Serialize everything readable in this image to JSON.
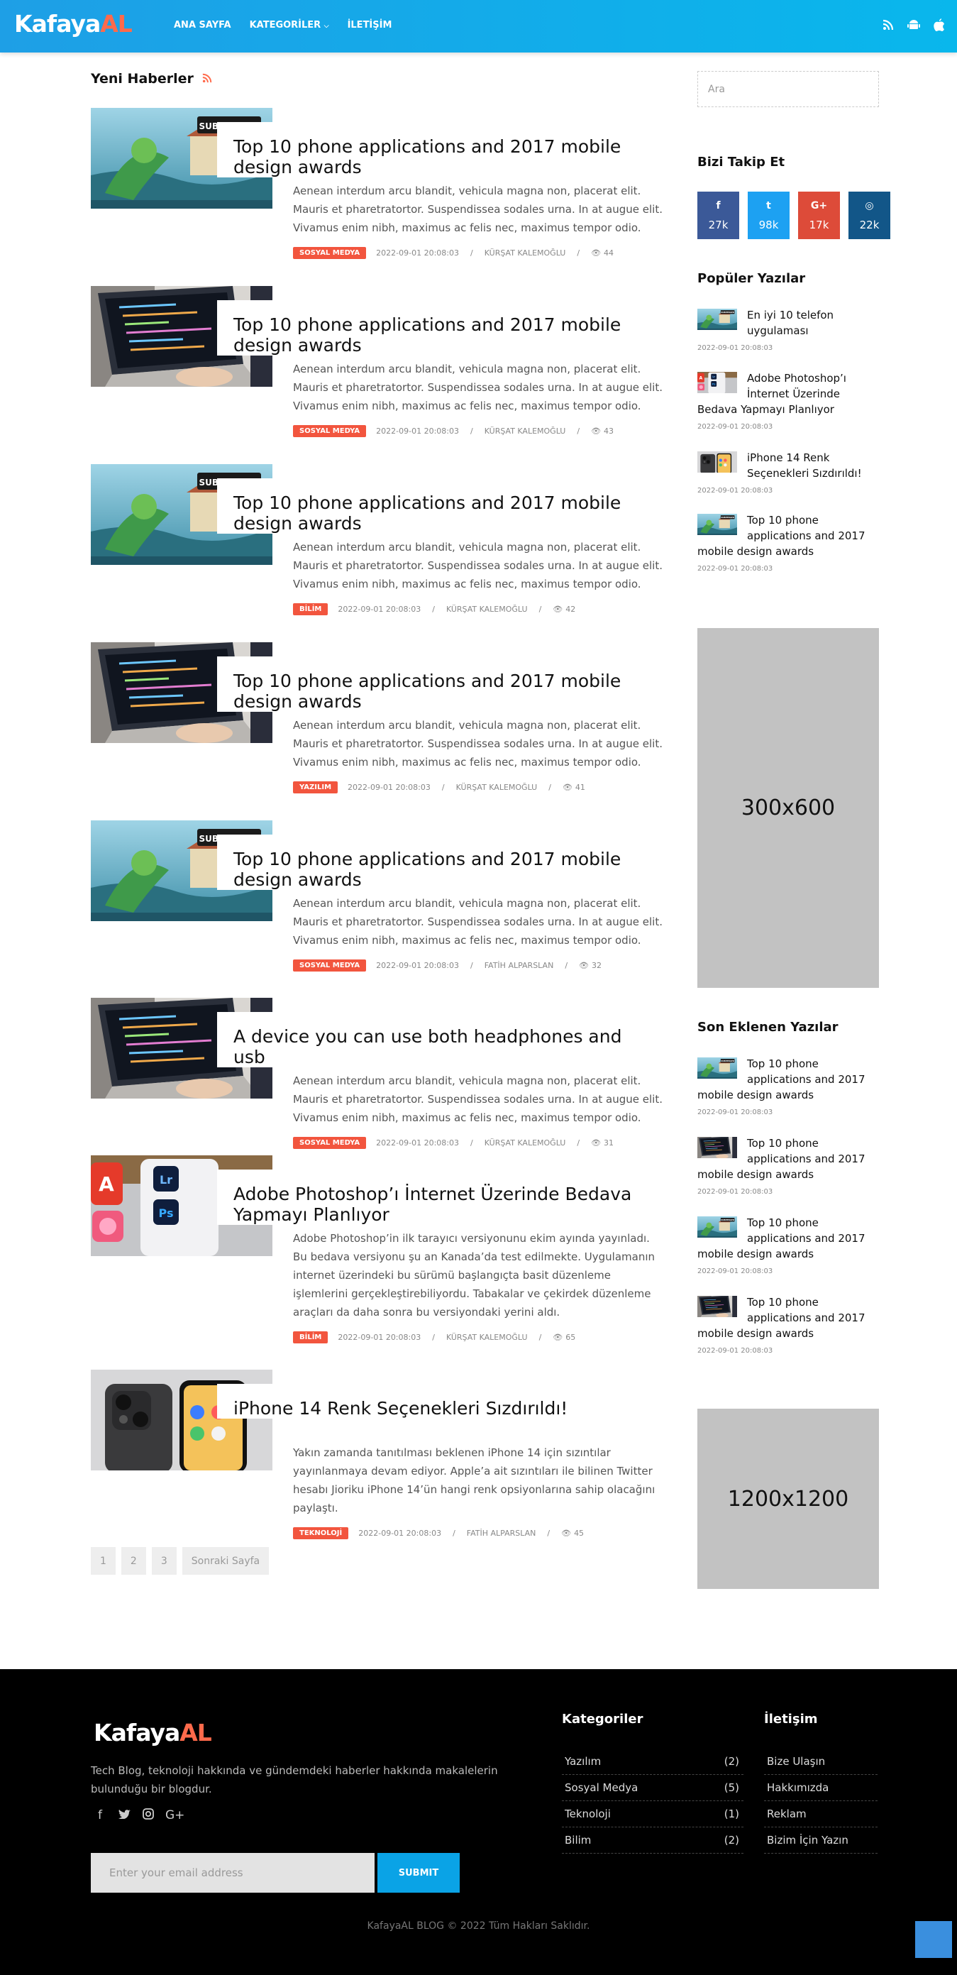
{
  "header": {
    "logo_main": "Kafaya",
    "logo_accent": "AL",
    "nav": [
      "ANA SAYFA",
      "KATEGORİLER",
      "İLETİŞİM"
    ],
    "icons": [
      "rss-icon",
      "android-icon",
      "apple-icon"
    ]
  },
  "main": {
    "section_title": "Yeni Haberler",
    "posts": [
      {
        "title": "Top 10 phone applications and 2017 mobile design awards",
        "excerpt": "Aenean interdum arcu blandit, vehicula magna non, placerat elit. Mauris et pharetratortor. Suspendissea sodales urna. In at augue elit. Vivamus enim nibh, maximus ac felis nec, maximus tempor odio.",
        "category": "SOSYAL MEDYA",
        "date": "2022-09-01 20:08:03",
        "author": "KÜRŞAT KALEMOĞLU",
        "views": "44",
        "image": "game"
      },
      {
        "title": "Top 10 phone applications and 2017 mobile design awards",
        "excerpt": "Aenean interdum arcu blandit, vehicula magna non, placerat elit. Mauris et pharetratortor. Suspendissea sodales urna. In at augue elit. Vivamus enim nibh, maximus ac felis nec, maximus tempor odio.",
        "category": "SOSYAL MEDYA",
        "date": "2022-09-01 20:08:03",
        "author": "KÜRŞAT KALEMOĞLU",
        "views": "43",
        "image": "laptop"
      },
      {
        "title": "Top 10 phone applications and 2017 mobile design awards",
        "excerpt": "Aenean interdum arcu blandit, vehicula magna non, placerat elit. Mauris et pharetratortor. Suspendissea sodales urna. In at augue elit. Vivamus enim nibh, maximus ac felis nec, maximus tempor odio.",
        "category": "BİLİM",
        "date": "2022-09-01 20:08:03",
        "author": "KÜRŞAT KALEMOĞLU",
        "views": "42",
        "image": "game"
      },
      {
        "title": "Top 10 phone applications and 2017 mobile design awards",
        "excerpt": "Aenean interdum arcu blandit, vehicula magna non, placerat elit. Mauris et pharetratortor. Suspendissea sodales urna. In at augue elit. Vivamus enim nibh, maximus ac felis nec, maximus tempor odio.",
        "category": "YAZILIM",
        "date": "2022-09-01 20:08:03",
        "author": "KÜRŞAT KALEMOĞLU",
        "views": "41",
        "image": "laptop"
      },
      {
        "title": "Top 10 phone applications and 2017 mobile design awards",
        "excerpt": "Aenean interdum arcu blandit, vehicula magna non, placerat elit. Mauris et pharetratortor. Suspendissea sodales urna. In at augue elit. Vivamus enim nibh, maximus ac felis nec, maximus tempor odio.",
        "category": "SOSYAL MEDYA",
        "date": "2022-09-01 20:08:03",
        "author": "FATİH ALPARSLAN",
        "views": "32",
        "image": "game"
      },
      {
        "title": "A device you can use both headphones and usb",
        "excerpt": "Aenean interdum arcu blandit, vehicula magna non, placerat elit. Mauris et pharetratortor. Suspendissea sodales urna. In at augue elit. Vivamus enim nibh, maximus ac felis nec, maximus tempor odio.",
        "category": "SOSYAL MEDYA",
        "date": "2022-09-01 20:08:03",
        "author": "KÜRŞAT KALEMOĞLU",
        "views": "31",
        "image": "laptop"
      },
      {
        "title": "Adobe Photoshop’ı İnternet Üzerinde Bedava Yapmayı Planlıyor",
        "excerpt": "Adobe Photoshop’in ilk tarayıcı versiyonunu ekim ayında yayınladı. Bu bedava versiyonu şu an Kanada’da test edilmekte. Uygulamanın internet üzerindeki bu sürümü başlangıçta basit düzenleme işlemlerini gerçekleştirebiliyordu. Tabakalar ve çekirdek düzenleme araçları da daha sonra bu versiyondaki yerini aldı.",
        "category": "BİLİM",
        "date": "2022-09-01 20:08:03",
        "author": "KÜRŞAT KALEMOĞLU",
        "views": "65",
        "image": "adobe"
      },
      {
        "title": "iPhone 14 Renk Seçenekleri Sızdırıldı!",
        "excerpt": "Yakın zamanda tanıtılması beklenen iPhone 14 için sızıntılar yayınlanmaya devam ediyor. Apple’a ait sızıntıları ile bilinen Twitter hesabı Jioriku iPhone 14’ün hangi renk opsiyonlarına sahip olacağını paylaştı.",
        "category": "TEKNOLOJİ",
        "date": "2022-09-01 20:08:03",
        "author": "FATİH ALPARSLAN",
        "views": "45",
        "image": "iphone"
      }
    ],
    "pager": [
      "1",
      "2",
      "3",
      "Sonraki Sayfa"
    ]
  },
  "sidebar": {
    "search_placeholder": "Ara",
    "follow_title": "Bizi Takip Et",
    "social": [
      {
        "icon": "facebook-icon",
        "glyph": "f",
        "count": "27k",
        "color": "#3b5998"
      },
      {
        "icon": "twitter-icon",
        "glyph": "t",
        "count": "98k",
        "color": "#1da1f2"
      },
      {
        "icon": "google-plus-icon",
        "glyph": "G+",
        "count": "17k",
        "color": "#dd4b39"
      },
      {
        "icon": "instagram-icon",
        "glyph": "◎",
        "count": "22k",
        "color": "#125688"
      }
    ],
    "popular_title": "Popüler Yazılar",
    "popular": [
      {
        "title": "En iyi 10 telefon uygulaması",
        "date": "2022-09-01 20:08:03",
        "image": "game"
      },
      {
        "title": "Adobe Photoshop’ı İnternet Üzerinde Bedava Yapmayı Planlıyor",
        "date": "2022-09-01 20:08:03",
        "image": "adobe"
      },
      {
        "title": "iPhone 14 Renk Seçenekleri Sızdırıldı!",
        "date": "2022-09-01 20:08:03",
        "image": "iphone"
      },
      {
        "title": "Top 10 phone applications and 2017 mobile design awards",
        "date": "2022-09-01 20:08:03",
        "image": "game"
      }
    ],
    "ad1": "300x600",
    "recent_title": "Son Eklenen Yazılar",
    "recent": [
      {
        "title": "Top 10 phone applications and 2017 mobile design awards",
        "date": "2022-09-01 20:08:03",
        "image": "game"
      },
      {
        "title": "Top 10 phone applications and 2017 mobile design awards",
        "date": "2022-09-01 20:08:03",
        "image": "laptop"
      },
      {
        "title": "Top 10 phone applications and 2017 mobile design awards",
        "date": "2022-09-01 20:08:03",
        "image": "game"
      },
      {
        "title": "Top 10 phone applications and 2017 mobile design awards",
        "date": "2022-09-01 20:08:03",
        "image": "laptop"
      }
    ],
    "ad2": "1200x1200"
  },
  "footer": {
    "logo_main": "Kafaya",
    "logo_accent": "AL",
    "description": "Tech Blog, teknoloji hakkında ve gündemdeki haberler hakkında makalelerin bulunduğu bir blogdur.",
    "social": [
      "facebook-icon",
      "twitter-icon",
      "instagram-icon",
      "google-plus-icon"
    ],
    "email_placeholder": "Enter your email address",
    "submit": "SUBMIT",
    "categories_title": "Kategoriler",
    "categories": [
      {
        "name": "Yazılım",
        "count": "(2)"
      },
      {
        "name": "Sosyal Medya",
        "count": "(5)"
      },
      {
        "name": "Teknoloji",
        "count": "(1)"
      },
      {
        "name": "Bilim",
        "count": "(2)"
      }
    ],
    "contact_title": "İletişim",
    "contact": [
      "Bize Ulaşın",
      "Hakkımızda",
      "Reklam",
      "Bizim İçin Yazın"
    ],
    "copyright": "KafayaAL BLOG © 2022 Tüm Hakları Saklıdır."
  }
}
